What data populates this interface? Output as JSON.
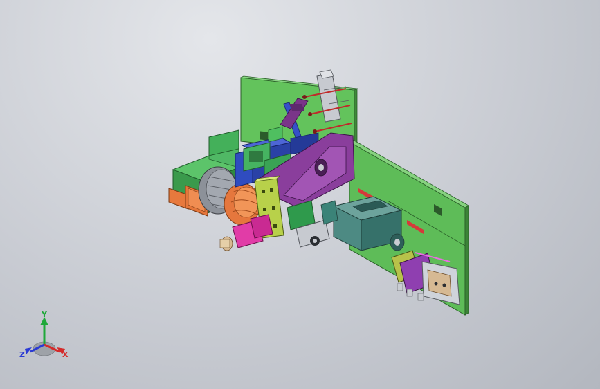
{
  "viewport": {
    "background_top": "#e4e6ea",
    "background_bottom": "#b3b7bf"
  },
  "colors": {
    "plate_green": "#5fbf5a",
    "plate_green_dark": "#3f8f3c",
    "block_green": "#3fa55c",
    "motor_orange": "#e4763a",
    "motor_gray": "#8a8f98",
    "arm_purple": "#8b3f9c",
    "arm_purple_dark": "#5e2a6e",
    "slide_blue": "#2f47b8",
    "cylinder_teal": "#4f8a84",
    "cylinder_teal_dark": "#2f5e59",
    "magenta": "#e23aa8",
    "yellow_green": "#c6d24a",
    "pink_frame": "#e86fe0",
    "steel": "#c9ccd2",
    "tan": "#d4b88a"
  },
  "triad": {
    "y_label": "Y",
    "x_label": "X",
    "z_label": "Z",
    "y_color": "#1fa83a",
    "x_color": "#d42a2a",
    "z_color": "#2a3ad4"
  }
}
